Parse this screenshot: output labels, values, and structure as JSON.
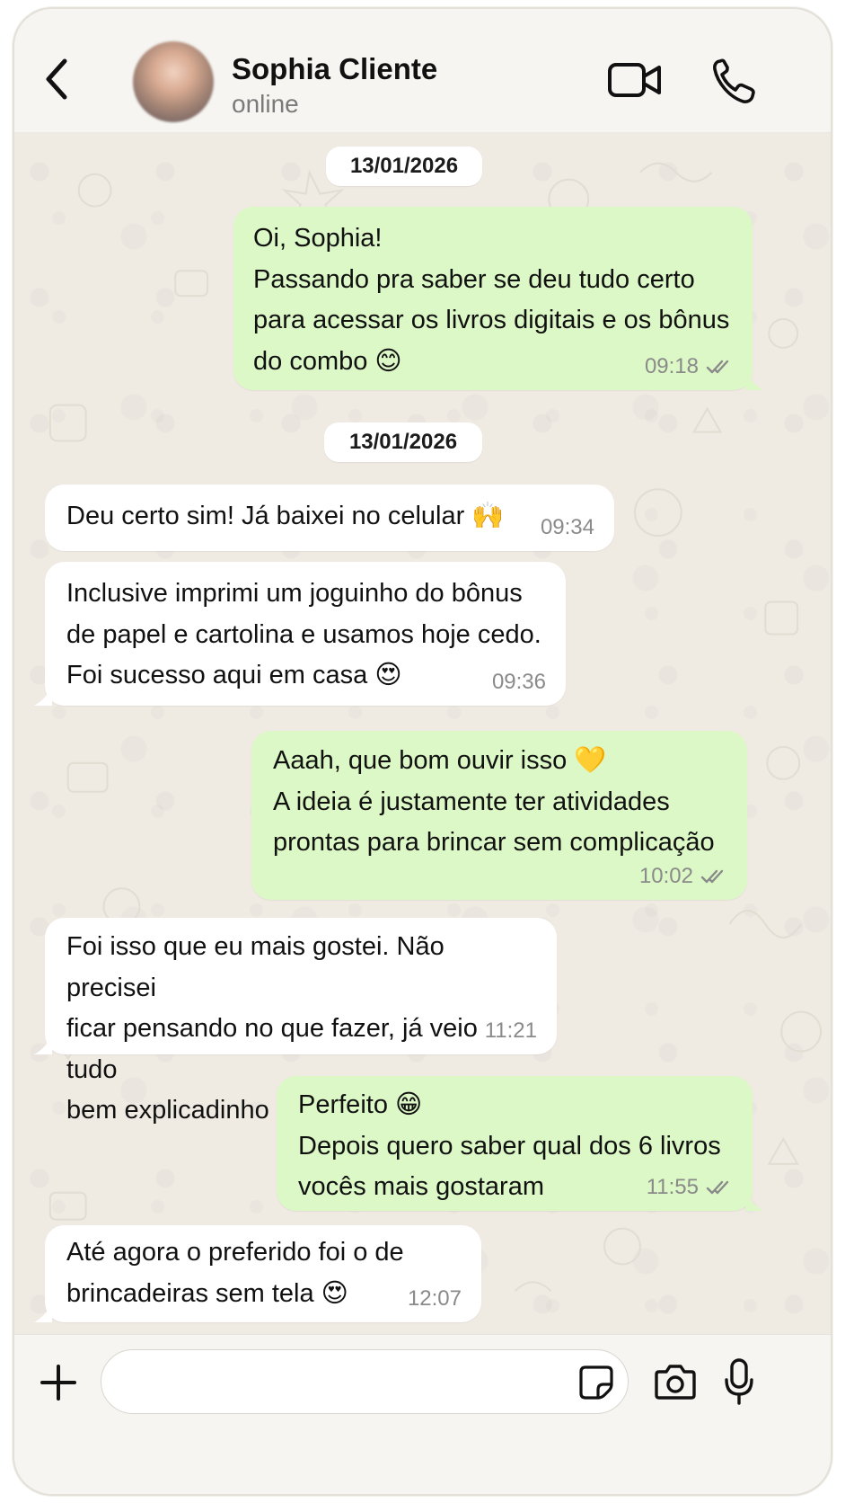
{
  "contact": {
    "name": "Sophia Cliente",
    "status": "online"
  },
  "icons": {
    "back": "chevron-left-icon",
    "video": "video-camera-icon",
    "call": "phone-icon",
    "add": "plus-icon",
    "sticker": "sticker-icon",
    "camera": "camera-icon",
    "mic": "microphone-icon"
  },
  "colors": {
    "outgoing_bubble": "#dcf8c6",
    "incoming_bubble": "#ffffff",
    "chat_background": "#efeae2",
    "read_ticks": "#8a8a8a"
  },
  "dates": [
    "13/01/2026",
    "13/01/2026"
  ],
  "messages": [
    {
      "direction": "out",
      "text": "Oi, Sophia!\nPassando pra saber se deu tudo certo\npara acessar os livros digitais e os bônus\ndo combo 😊",
      "time": "09:18",
      "status": "read"
    },
    {
      "direction": "in",
      "text": "Deu certo sim! Já baixei no celular 🙌",
      "time": "09:34"
    },
    {
      "direction": "in",
      "text": "Inclusive imprimi um joguinho do bônus\nde papel e cartolina e usamos hoje cedo.\nFoi sucesso aqui em casa 😍",
      "time": "09:36"
    },
    {
      "direction": "out",
      "text": "Aaah, que bom ouvir isso 💛\nA ideia é justamente ter atividades\nprontas para brincar sem complicação",
      "time": "10:02",
      "status": "read"
    },
    {
      "direction": "in",
      "text": "Foi isso que eu mais gostei. Não precisei\nficar pensando no que fazer, já veio tudo\nbem explicadinho e organizado",
      "time": "11:21"
    },
    {
      "direction": "out",
      "text": "Perfeito 😁\nDepois quero saber qual dos 6 livros\nvocês mais gostaram",
      "time": "11:55",
      "status": "read"
    },
    {
      "direction": "in",
      "text": "Até agora o preferido foi o de\nbrincadeiras sem tela 😍",
      "time": "12:07"
    }
  ],
  "composer": {
    "value": "",
    "placeholder": ""
  }
}
